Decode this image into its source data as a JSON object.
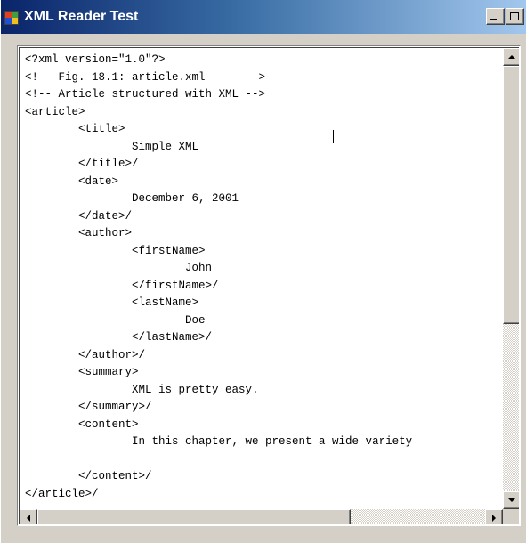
{
  "window": {
    "title": "XML Reader Test",
    "icon": "app-window-icon"
  },
  "caption_buttons": {
    "minimize": "minimize-icon",
    "maximize": "maximize-icon",
    "close": "close-icon"
  },
  "textbox": {
    "lines": [
      "<?xml version=\"1.0\"?>",
      "<!-- Fig. 18.1: article.xml      -->",
      "<!-- Article structured with XML -->",
      "<article>",
      "        <title>",
      "                Simple XML",
      "        </title>/",
      "        <date>",
      "                December 6, 2001",
      "        </date>/",
      "        <author>",
      "                <firstName>",
      "                        John",
      "                </firstName>/",
      "                <lastName>",
      "                        Doe",
      "                </lastName>/",
      "        </author>/",
      "        <summary>",
      "                XML is pretty easy.",
      "        </summary>/",
      "        <content>",
      "                In this chapter, we present a wide variety",
      "",
      "        </content>/",
      "</article>/"
    ]
  },
  "scrollbars": {
    "vertical": {
      "up": "arrow-up-icon",
      "down": "arrow-down-icon"
    },
    "horizontal": {
      "left": "arrow-left-icon",
      "right": "arrow-right-icon"
    }
  }
}
